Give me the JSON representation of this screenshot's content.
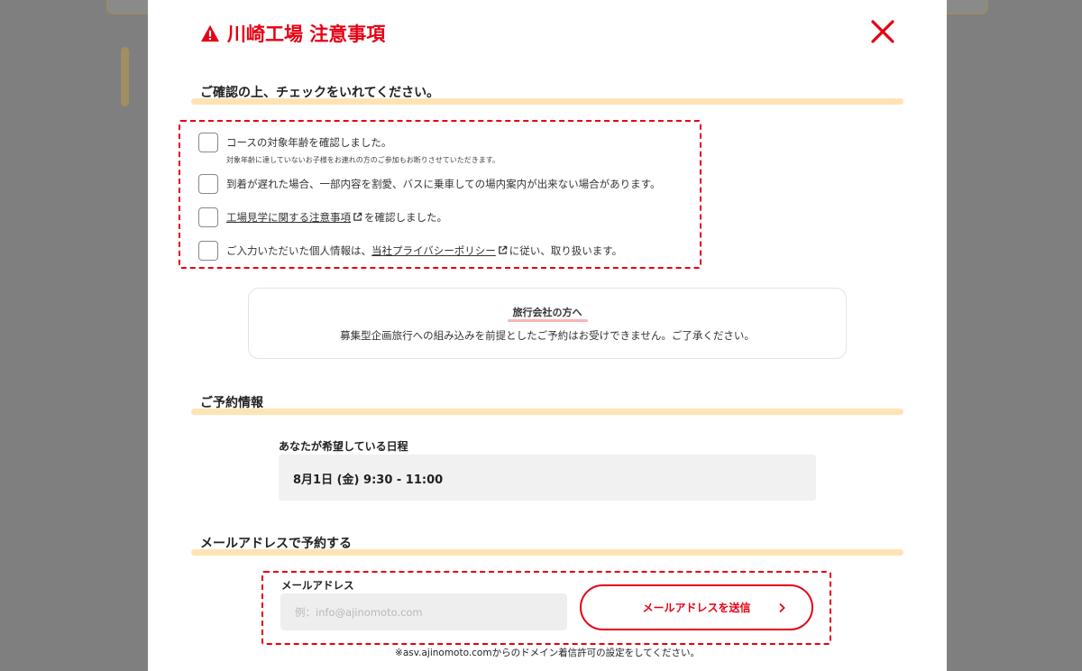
{
  "modal": {
    "title": "川崎工場 注意事項",
    "accent_color": "#e60012",
    "icons": {
      "title": "warning-icon",
      "close": "close-icon",
      "external": "external-link-icon",
      "button": "chevron-right-icon"
    }
  },
  "confirm": {
    "heading": "ご確認の上、チェックをいれてください。",
    "items": [
      {
        "text": "コースの対象年齢を確認しました。",
        "sub": "対象年齢に達していないお子様をお連れの方のご参加もお断りさせていただきます。",
        "checked": false
      },
      {
        "text": "到着が遅れた場合、一部内容を割愛、バスに乗車しての場内案内が出来ない場合があります。",
        "checked": false
      },
      {
        "link": "工場見学に関する注意事項",
        "after": "を確認しました。",
        "checked": false
      },
      {
        "before": "ご入力いただいた個人情報は、",
        "link": "当社プライバシーポリシー",
        "after": "に従い、取り扱います。",
        "checked": false
      }
    ]
  },
  "agency": {
    "heading": "旅行会社の方へ",
    "body": "募集型企画旅行への組み込みを前提としたご予約はお受けできません。ご了承ください。"
  },
  "reservation": {
    "heading": "ご予約情報",
    "date_label": "あなたが希望している日程",
    "date_value": "8月1日 (金) 9:30 - 11:00"
  },
  "email": {
    "heading": "メールアドレスで予約する",
    "label": "メールアドレス",
    "value": "",
    "placeholder": "例：info@ajinomoto.com",
    "button": "メールアドレスを送信",
    "note": "※asv.ajinomoto.comからのドメイン着信許可の設定をしてください。"
  }
}
